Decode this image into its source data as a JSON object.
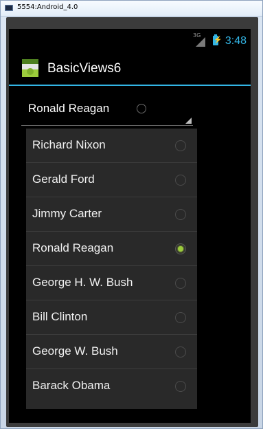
{
  "window": {
    "title": "5554:Android_4.0"
  },
  "status_bar": {
    "network": "3G",
    "time": "3:48"
  },
  "action_bar": {
    "app_title": "BasicViews6",
    "app_icon": "android-app-icon"
  },
  "spinner": {
    "selected": "Ronald Reagan"
  },
  "list": {
    "items": [
      {
        "label": "Richard Nixon",
        "checked": false
      },
      {
        "label": "Gerald Ford",
        "checked": false
      },
      {
        "label": "Jimmy Carter",
        "checked": false
      },
      {
        "label": "Ronald Reagan",
        "checked": true
      },
      {
        "label": "George H. W. Bush",
        "checked": false
      },
      {
        "label": "Bill Clinton",
        "checked": false
      },
      {
        "label": "George W. Bush",
        "checked": false
      },
      {
        "label": "Barack Obama",
        "checked": false
      }
    ]
  },
  "colors": {
    "accent": "#33b5e5",
    "radio_checked": "#9ccc3c",
    "background": "#000000"
  }
}
